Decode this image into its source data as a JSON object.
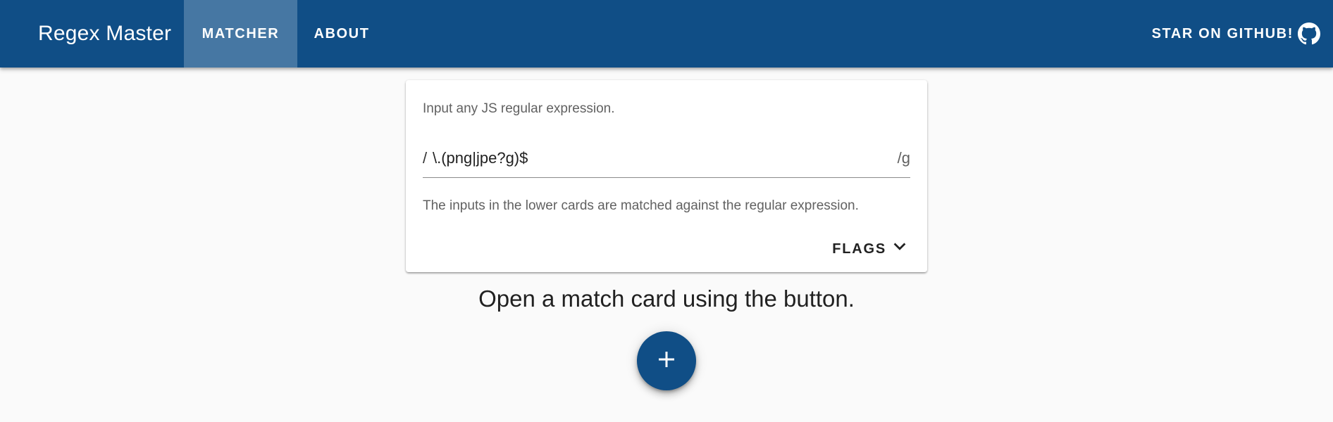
{
  "app": {
    "title": "Regex Master"
  },
  "nav": {
    "tabs": [
      {
        "label": "MATCHER",
        "active": true
      },
      {
        "label": "ABOUT",
        "active": false
      }
    ],
    "github_label": "STAR ON GITHUB!",
    "github_icon": "github-icon"
  },
  "regex_card": {
    "helper_top": "Input any JS regular expression.",
    "prefix": "/",
    "value": "\\.(png|jpe?g)$",
    "suffix": "/g",
    "helper_bottom": "The inputs in the lower cards are matched against the regular expression.",
    "flags_label": "FLAGS",
    "flags_icon": "chevron-down-icon"
  },
  "empty_state": {
    "message": "Open a match card using the button.",
    "add_icon": "plus-icon"
  },
  "colors": {
    "primary": "#104e86",
    "active_tab": "#4677a3",
    "background": "#fafafa",
    "card": "#ffffff"
  }
}
